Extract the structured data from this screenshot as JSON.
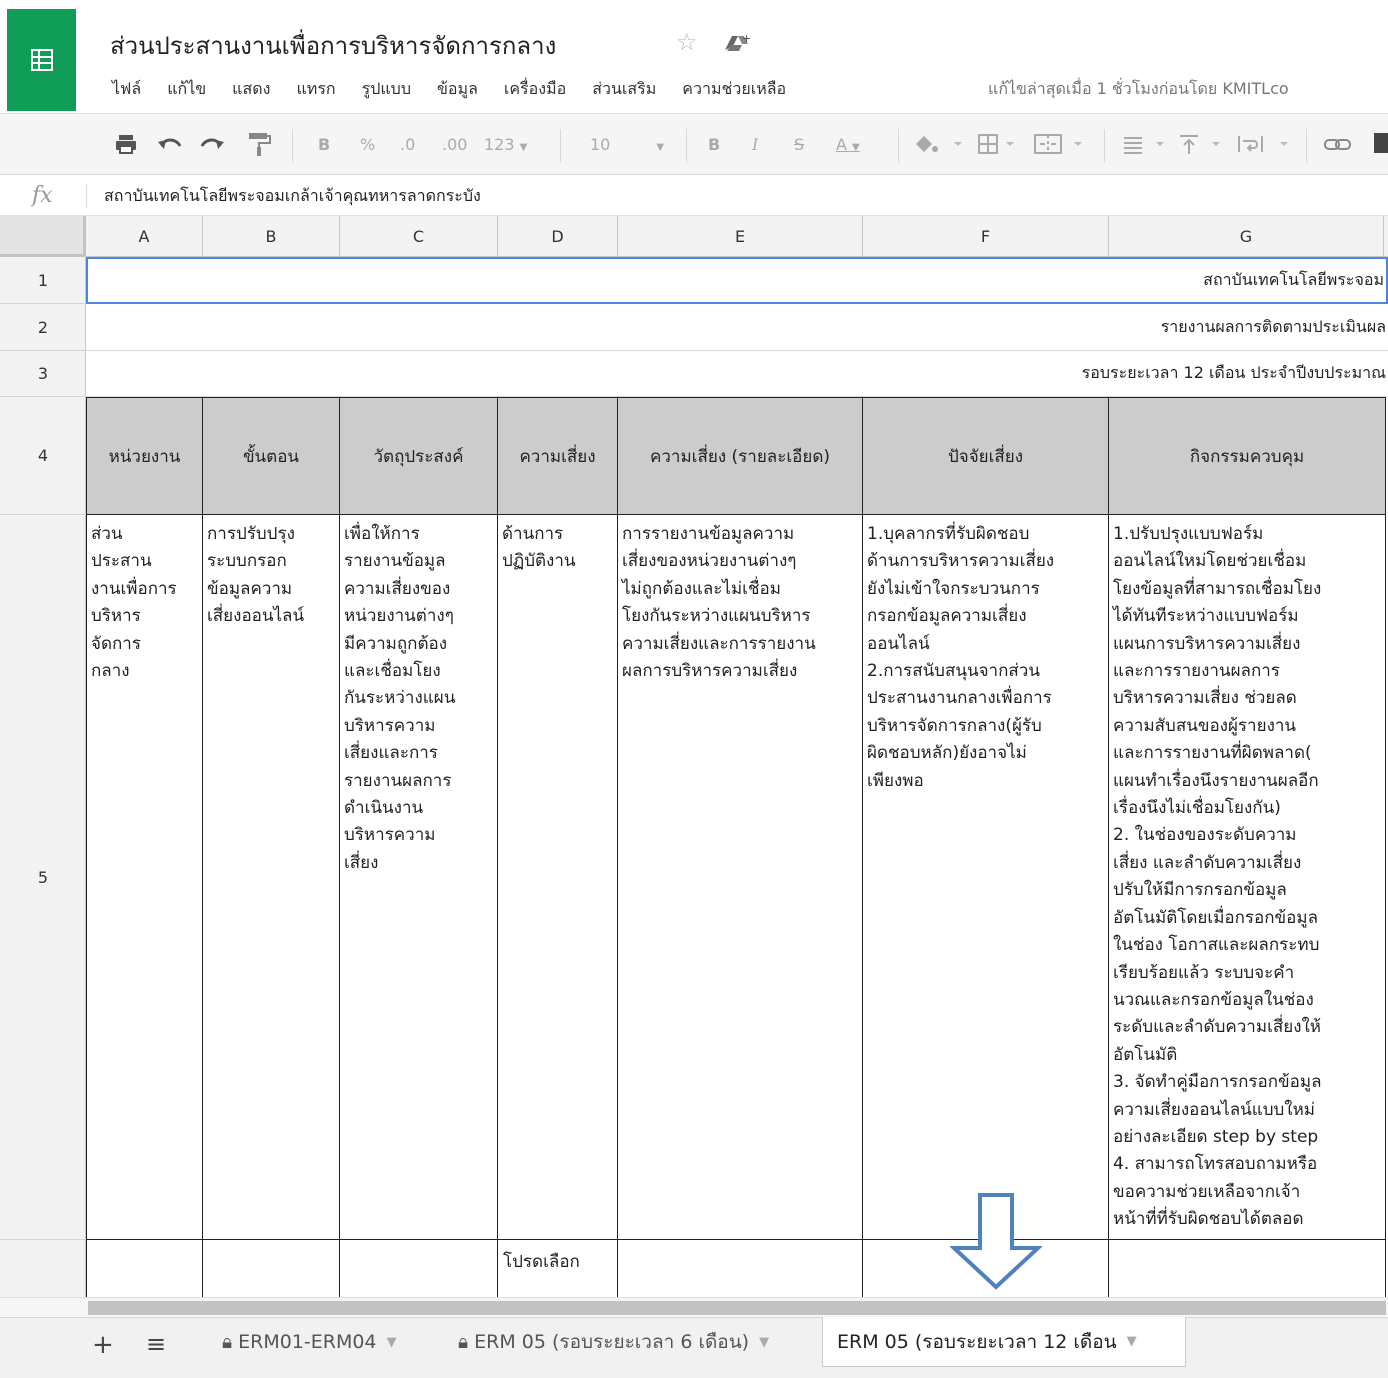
{
  "doc": {
    "title": "ส่วนประสานงานเพื่อการบริหารจัดการกลาง",
    "last_edit": "แก้ไขล่าสุดเมื่อ 1 ชั่วโมงก่อนโดย KMITLco"
  },
  "menu": [
    "ไฟล์",
    "แก้ไข",
    "แสดง",
    "แทรก",
    "รูปแบบ",
    "ข้อมูล",
    "เครื่องมือ",
    "ส่วนเสริม",
    "ความช่วยเหลือ"
  ],
  "toolbar": {
    "bold": "B",
    "percent": "%",
    "dec_less": ".0",
    "dec_more": ".00",
    "num_format": "123",
    "font_size": "10",
    "bold2": "B",
    "italic": "I",
    "strike": "S",
    "text_color": "A"
  },
  "formula_bar": {
    "fx": "fx",
    "content": "สถาบันเทคโนโลยีพระจอมเกล้าเจ้าคุณทหารลาดกระบัง"
  },
  "columns": [
    "A",
    "B",
    "C",
    "D",
    "E",
    "F",
    "G"
  ],
  "rows": [
    "1",
    "2",
    "3",
    "4",
    "5"
  ],
  "merged_rows": {
    "r1": "สถาบันเทคโนโลยีพระจอม",
    "r2": "รายงานผลการติดตามประเมินผล",
    "r3": "รอบระยะเวลา 12 เดือน ประจำปีงบประมาณ"
  },
  "table": {
    "headers": [
      "หน่วยงาน",
      "ขั้นตอน",
      "วัตถุประสงค์",
      "ความเสี่ยง",
      "ความเสี่ยง (รายละเอียด)",
      "ปัจจัยเสี่ยง",
      "กิจกรรมควบคุม"
    ],
    "row5": [
      "ส่วน\nประสาน\nงานเพื่อการ\nบริหาร\nจัดการ\nกลาง",
      "การปรับปรุง\nระบบกรอก\nข้อมูลความ\nเสี่ยงออนไลน์",
      "เพื่อให้การ\nรายงานข้อมูล\nความเสี่ยงของ\nหน่วยงานต่างๆ\nมีความถูกต้อง\nและเชื่อมโยง\nกันระหว่างแผน\nบริหารความ\nเสี่ยงและการ\nรายงานผลการ\nดำเนินงาน\nบริหารความ\nเสี่ยง",
      "ด้านการ\nปฏิบัติงาน",
      "การรายงานข้อมูลความ\nเสี่ยงของหน่วยงานต่างๆ\nไม่ถูกต้องและไม่เชื่อม\nโยงกันระหว่างแผนบริหาร\nความเสี่ยงและการรายงาน\nผลการบริหารความเสี่ยง",
      "1.บุคลากรที่รับผิดชอบ\nด้านการบริหารความเสี่ยง\nยังไม่เข้าใจกระบวนการ\nกรอกข้อมูลความเสี่ยง\nออนไลน์\n2.การสนับสนุนจากส่วน\nประสานงานกลางเพื่อการ\nบริหารจัดการกลาง(ผู้รับ\nผิดชอบหลัก)ยังอาจไม่\nเพียงพอ",
      "1.ปรับปรุงแบบฟอร์ม\nออนไลน์ใหม่โดยช่วยเชื่อม\nโยงข้อมูลที่สามารถเชื่อมโยง\nได้ทันทีระหว่างแบบฟอร์ม\nแผนการบริหารความเสี่ยง\nและการรายงานผลการ\nบริหารความเสี่ยง ช่วยลด\nความสับสนของผู้รายงาน\nและการรายงานที่ผิดพลาด(\nแผนทำเรื่องนึงรายงานผลอีก\nเรื่องนึงไม่เชื่อมโยงกัน)\n2. ในช่องของระดับความ\nเสี่ยง และลำดับความเสี่ยง\nปรับให้มีการกรอกข้อมูล\nอัตโนมัติโดยเมื่อกรอกข้อมูล\nในช่อง โอกาสและผลกระทบ\nเรียบร้อยแล้ว ระบบจะคำ\nนวณและกรอกข้อมูลในช่อง\nระดับและลำดับความเสี่ยงให้\nอัตโนมัติ\n3. จัดทำคู่มือการกรอกข้อมูล\nความเสี่ยงออนไลน์แบบใหม่\nอย่างละเอียด step by step\n4. สามารถโทรสอบถามหรือ\nขอความช่วยเหลือจากเจ้า\nหน้าที่ที่รับผิดชอบได้ตลอด"
    ],
    "row6_d": "โปรดเลือก"
  },
  "sheets": [
    {
      "label": "ERM01-ERM04",
      "locked": true
    },
    {
      "label": "ERM 05 (รอบระยะเวลา 6 เดือน)",
      "locked": true
    },
    {
      "label": "ERM 05 (รอบระยะเวลา 12 เดือน",
      "locked": false
    }
  ],
  "colors": {
    "brand": "#0f9d58",
    "selection": "#4a86e8",
    "header_fill": "#cccccc",
    "arrow": "#4f81bd"
  }
}
